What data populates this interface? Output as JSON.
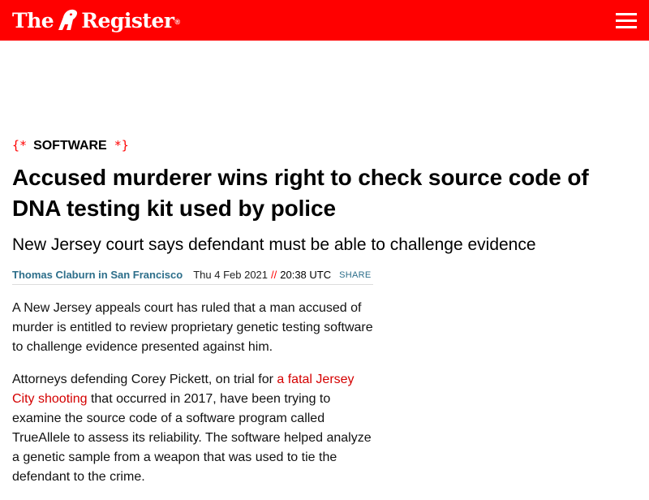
{
  "header": {
    "logo_part1": "The",
    "logo_part2": "Register",
    "logo_mark": "®",
    "accent_color": "#ff0000",
    "menu_icon": "hamburger-menu-icon"
  },
  "article": {
    "section_open": "{*",
    "section": "SOFTWARE",
    "section_close": "*}",
    "title": "Accused murderer wins right to check source code of DNA testing kit used by police",
    "standfirst": "New Jersey court says defendant must be able to challenge evidence",
    "author": "Thomas Claburn in San Francisco",
    "date": "Thu 4 Feb 2021",
    "time_separator": "//",
    "time": "20:38 UTC",
    "share_label": "SHARE",
    "paragraph1": "A New Jersey appeals court has ruled that a man accused of murder is entitled to review proprietary genetic testing software to challenge evidence presented against him.",
    "paragraph2_before": "Attorneys defending Corey Pickett, on trial for ",
    "paragraph2_link": "a fatal Jersey City shooting",
    "paragraph2_after": " that occurred in 2017, have been trying to examine the source code of a software program called TrueAllele to assess its reliability. The software helped analyze a genetic sample from a weapon that was used to tie the defendant to the crime."
  }
}
